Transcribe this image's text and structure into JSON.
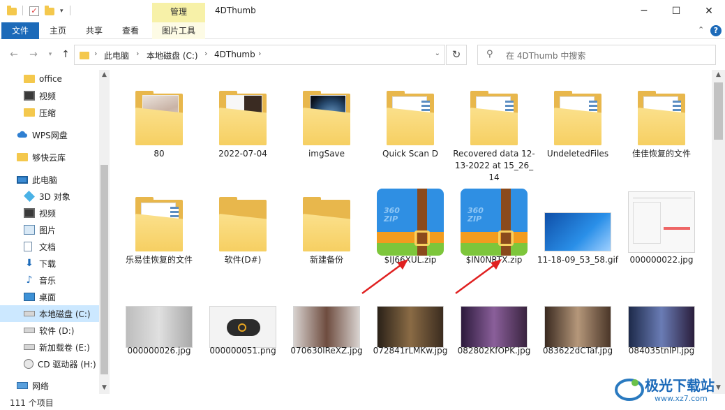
{
  "window": {
    "title": "4DThumb",
    "context_tab": "管理",
    "min": "─",
    "max": "☐",
    "close": "✕"
  },
  "ribbon": {
    "tabs": [
      "文件",
      "主页",
      "共享",
      "查看",
      "图片工具"
    ],
    "help": "?",
    "collapse": "⌃"
  },
  "address": {
    "crumbs": [
      "此电脑",
      "本地磁盘 (C:)",
      "4DThumb"
    ],
    "separator": "›",
    "search_placeholder": "在 4DThumb 中搜索"
  },
  "nav_items": [
    {
      "label": "office",
      "icon": "folder-icon"
    },
    {
      "label": "视频",
      "icon": "video-icon"
    },
    {
      "label": "压缩",
      "icon": "folder-icon"
    },
    {
      "label": "WPS网盘",
      "icon": "cloud-icon"
    },
    {
      "label": "够快云库",
      "icon": "folder-icon"
    },
    {
      "label": "此电脑",
      "icon": "pc-icon"
    },
    {
      "label": "3D 对象",
      "icon": "cube-icon"
    },
    {
      "label": "视频",
      "icon": "video-icon"
    },
    {
      "label": "图片",
      "icon": "picture-icon"
    },
    {
      "label": "文档",
      "icon": "document-icon"
    },
    {
      "label": "下载",
      "icon": "download-icon"
    },
    {
      "label": "音乐",
      "icon": "music-icon"
    },
    {
      "label": "桌面",
      "icon": "desktop-icon"
    },
    {
      "label": "本地磁盘 (C:)",
      "icon": "drive-icon",
      "selected": true
    },
    {
      "label": "软件 (D:)",
      "icon": "drive-icon"
    },
    {
      "label": "新加载卷 (E:)",
      "icon": "drive-icon"
    },
    {
      "label": "CD 驱动器 (H:)",
      "icon": "cd-drive-icon"
    },
    {
      "label": "网络",
      "icon": "network-icon"
    }
  ],
  "files_row1": [
    {
      "name": "80",
      "kind": "folder"
    },
    {
      "name": "2022-07-04",
      "kind": "folder"
    },
    {
      "name": "imgSave",
      "kind": "folder"
    },
    {
      "name": "Quick Scan D",
      "kind": "folder"
    },
    {
      "name": "Recovered data 12-13-2022 at 15_26_14",
      "kind": "folder"
    },
    {
      "name": "UndeletedFiles",
      "kind": "folder"
    },
    {
      "name": "佳佳恢复的文件",
      "kind": "folder"
    }
  ],
  "files_row2": [
    {
      "name": "乐易佳恢复的文件",
      "kind": "folder"
    },
    {
      "name": "软件(D#)",
      "kind": "folder"
    },
    {
      "name": "新建备份",
      "kind": "folder"
    },
    {
      "name": "$IJ66XUL.zip",
      "kind": "zip"
    },
    {
      "name": "$IN0NRTX.zip",
      "kind": "zip"
    },
    {
      "name": "11-18-09_53_58.gif",
      "kind": "image"
    },
    {
      "name": "000000022.jpg",
      "kind": "image"
    }
  ],
  "files_row3": [
    {
      "name": "000000026.jpg",
      "kind": "image"
    },
    {
      "name": "000000051.png",
      "kind": "image"
    },
    {
      "name": "070630lReXZ.jpg",
      "kind": "image"
    },
    {
      "name": "072841rLMKw.jpg",
      "kind": "image"
    },
    {
      "name": "082802KfOPK.jpg",
      "kind": "image"
    },
    {
      "name": "083622dCTaf.jpg",
      "kind": "image"
    },
    {
      "name": "084035tnlPl.jpg",
      "kind": "image"
    }
  ],
  "zip_brand": "360\nZIP",
  "status": {
    "count": "111 个项目"
  },
  "watermark": {
    "text": "极光下载站",
    "url": "www.xz7.com"
  },
  "colors": {
    "accent": "#1c6ab9",
    "selected": "#cce8ff",
    "folder": "#f6cf62",
    "arrow": "#e02020"
  }
}
